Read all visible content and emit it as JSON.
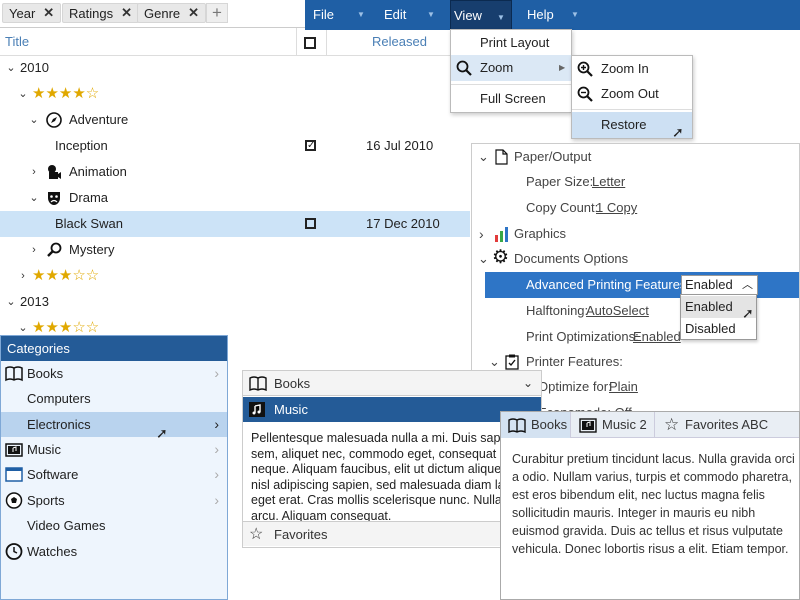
{
  "groupbar": {
    "chips": [
      "Year",
      "Ratings",
      "Genre"
    ],
    "add_label": "+"
  },
  "tree": {
    "headers": {
      "title": "Title",
      "released": "Released"
    },
    "rows": [
      {
        "label": "2010"
      },
      {
        "stars": "★★★★☆"
      },
      {
        "label": "Adventure"
      },
      {
        "label": "Inception",
        "date": "16 Jul 2010",
        "checked": true
      },
      {
        "label": "Animation"
      },
      {
        "label": "Drama"
      },
      {
        "label": "Black Swan",
        "date": "17 Dec 2010",
        "checked": false
      },
      {
        "label": "Mystery"
      },
      {
        "stars": "★★★☆☆"
      },
      {
        "label": "2013"
      },
      {
        "stars": "★★★☆☆"
      }
    ]
  },
  "menubar": {
    "items": [
      "File",
      "Edit",
      "View",
      "Help"
    ]
  },
  "view_menu": {
    "items": [
      "Print Layout",
      "Zoom",
      "Full Screen"
    ]
  },
  "zoom_menu": {
    "items": [
      "Zoom In",
      "Zoom Out",
      "Restore"
    ]
  },
  "propgrid": {
    "paper_output": "Paper/Output",
    "paper_size_label": "Paper Size:",
    "paper_size_value": "Letter",
    "copy_count_label": "Copy Count:",
    "copy_count_value": "1 Copy",
    "graphics": "Graphics",
    "documents_options": "Documents Options",
    "advanced_label": "Advanced Printing Features:",
    "advanced_value": "Enabled",
    "halftoning_label": "Halftoning:",
    "halftoning_value": "AutoSelect",
    "print_opt_label": "Print Optimizations:",
    "print_opt_value": "Enabled",
    "printer_features": "Printer Features:",
    "optimize_label": "Optimize for:",
    "optimize_value": "Plain",
    "econo_label": "Economode: Off",
    "options": [
      "Enabled",
      "Disabled"
    ]
  },
  "categories": {
    "header": "Categories",
    "items": [
      "Books",
      "Computers",
      "Electronics",
      "Music",
      "Software",
      "Sports",
      "Video Games",
      "Watches"
    ]
  },
  "accordion": {
    "books": "Books",
    "music": "Music",
    "text": "Pellentesque malesuada nulla a mi. Duis sapien sem, aliquet nec, commodo eget, consequat quis, neque. Aliquam faucibus, elit ut dictum aliquet, felis nisl adipiscing sapien, sed malesuada diam lacus eget erat. Cras mollis scelerisque nunc. Nullam arcu. Aliquam consequat.",
    "favorites": "Favorites"
  },
  "tabs": {
    "labels": [
      "Books",
      "Music 2",
      "Favorites ABC"
    ],
    "text": "Curabitur pretium tincidunt lacus. Nulla gravida orci a odio. Nullam varius, turpis et commodo pharetra, est eros bibendum elit, nec luctus magna felis sollicitudin mauris. Integer in mauris eu nibh euismod gravida. Duis ac tellus et risus vulputate vehicula. Donec lobortis risus a elit. Etiam tempor."
  },
  "colors": {
    "accent": "#1f5fa5",
    "header_dark": "#245b97",
    "selection": "#2e75c6",
    "star": "#e0a800"
  }
}
